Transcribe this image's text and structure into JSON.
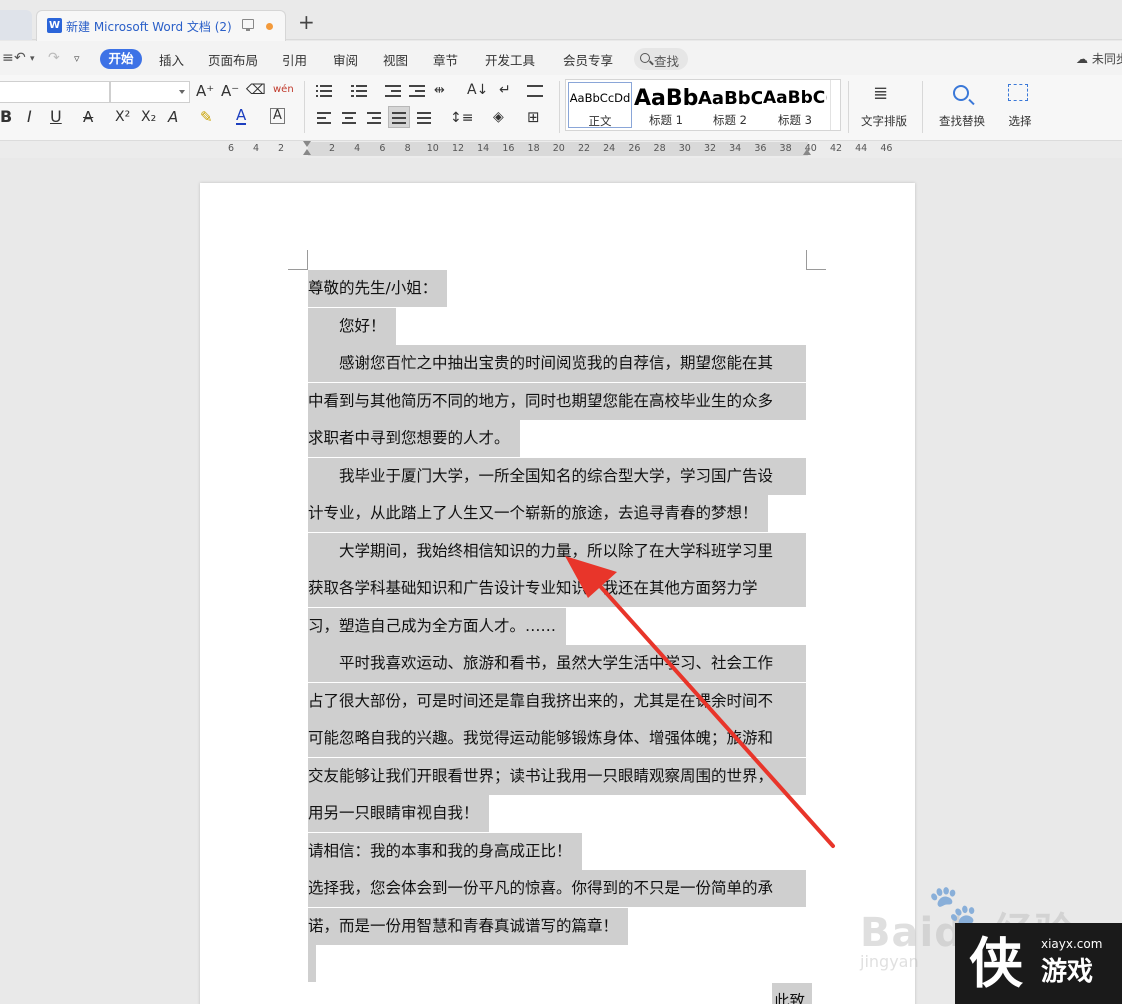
{
  "tab": {
    "title": "新建 Microsoft Word 文档 (2)",
    "new_tab_icon": "plus-icon",
    "doc_icon": "W"
  },
  "menu": {
    "items": [
      "开始",
      "插入",
      "页面布局",
      "引用",
      "审阅",
      "视图",
      "章节",
      "开发工具",
      "会员专享"
    ],
    "search_label": "查找",
    "sync_label": "未同步"
  },
  "ribbon": {
    "font_labels": [
      "A⁺",
      "A⁻",
      "wén"
    ],
    "format_labels": [
      "B",
      "I",
      "U",
      "A",
      "X²",
      "X₂",
      "A",
      "A"
    ],
    "styles": [
      {
        "sample": "AaBbCcDd",
        "name": "正文"
      },
      {
        "sample": "AaBb",
        "name": "标题 1"
      },
      {
        "sample": "AaBbC(",
        "name": "标题 2"
      },
      {
        "sample": "AaBbC(",
        "name": "标题 3"
      }
    ],
    "text_layout_label": "文字排版",
    "find_replace_label": "查找替换",
    "select_label": "选择"
  },
  "ruler": {
    "left_numbers": [
      "6",
      "4",
      "2"
    ],
    "numbers": [
      "2",
      "4",
      "6",
      "8",
      "10",
      "12",
      "14",
      "16",
      "18",
      "20",
      "22",
      "24",
      "26",
      "28",
      "30",
      "32",
      "34",
      "36",
      "38",
      "40",
      "42",
      "44",
      "46"
    ]
  },
  "document": {
    "lines": [
      "尊敬的先生/小姐：",
      "　　您好！",
      "　　感谢您百忙之中抽出宝贵的时间阅览我的自荐信，期望您能在其",
      "中看到与其他简历不同的地方，同时也期望您能在高校毕业生的众多",
      "求职者中寻到您想要的人才。",
      "　　我毕业于厦门大学，一所全国知名的综合型大学，学习国广告设",
      "计专业，从此踏上了人生又一个崭新的旅途，去追寻青春的梦想！",
      "　　大学期间，我始终相信知识的力量，所以除了在大学科班学习里",
      "获取各学科基础知识和广告设计专业知识，我还在其他方面努力学",
      "习，塑造自己成为全方面人才。……",
      "　　平时我喜欢运动、旅游和看书，虽然大学生活中学习、社会工作",
      "占了很大部份，可是时间还是靠自我挤出来的，尤其是在课余时间不",
      "可能忽略自我的兴趣。我觉得运动能够锻炼身体、增强体魄；旅游和",
      "交友能够让我们开眼看世界；读书让我用一只眼睛观察周围的世界，",
      "用另一只眼睛审视自我！",
      "请相信：我的本事和我的身高成正比！",
      "选择我，您会体会到一份平凡的惊喜。你得到的不只是一份简单的承",
      "诺，而是一份用智慧和青春真诚谱写的篇章！",
      "",
      "此致"
    ]
  },
  "annotation": {
    "color": "#e8352a"
  },
  "watermark": {
    "baidu_text": "Baidu经验",
    "baidu_sub": "jingyan",
    "site": "xiayx.com",
    "logo": "侠",
    "name": "游戏"
  }
}
